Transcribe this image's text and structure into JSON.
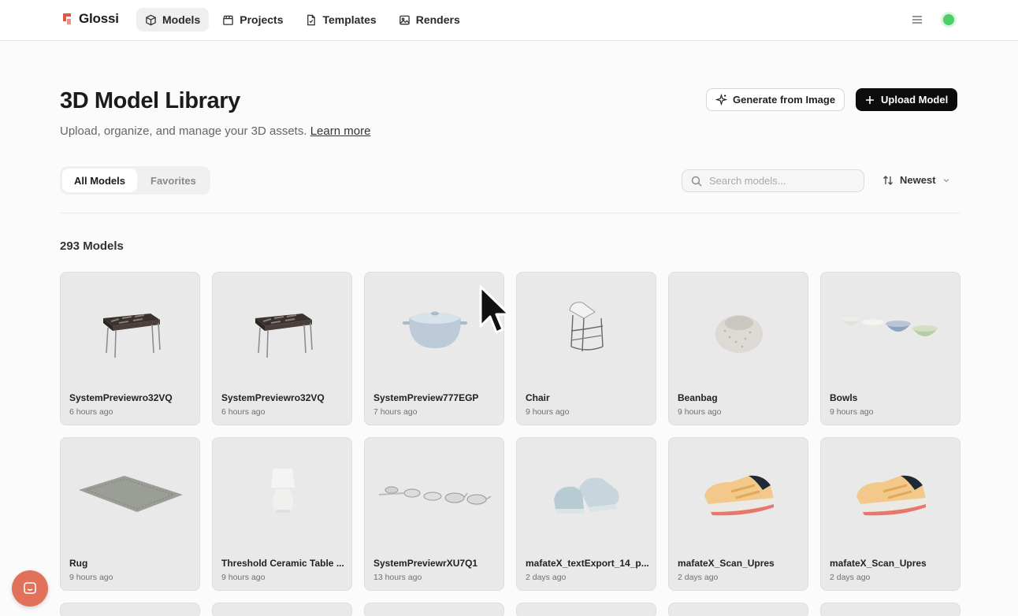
{
  "brand": {
    "name": "Glossi",
    "accent": "#e2563f"
  },
  "nav": [
    {
      "label": "Models",
      "icon": "cube-icon",
      "active": true
    },
    {
      "label": "Projects",
      "icon": "clapper-icon",
      "active": false
    },
    {
      "label": "Templates",
      "icon": "file-icon",
      "active": false
    },
    {
      "label": "Renders",
      "icon": "image-icon",
      "active": false
    }
  ],
  "header": {
    "title": "3D Model Library",
    "subtitle": "Upload, organize, and manage your 3D assets.",
    "learn_more": "Learn more",
    "generate_label": "Generate from Image",
    "upload_label": "Upload Model"
  },
  "filters": {
    "tabs": [
      "All Models",
      "Favorites"
    ],
    "active_tab": "All Models",
    "search_placeholder": "Search models...",
    "sort_label": "Newest"
  },
  "count_label": "293 Models",
  "models": [
    {
      "name": "SystemPreviewro32VQ",
      "time": "6 hours ago",
      "thumb": "table"
    },
    {
      "name": "SystemPreviewro32VQ",
      "time": "6 hours ago",
      "thumb": "table"
    },
    {
      "name": "SystemPreview777EGP",
      "time": "7 hours ago",
      "thumb": "pot"
    },
    {
      "name": "Chair",
      "time": "9 hours ago",
      "thumb": "chair"
    },
    {
      "name": "Beanbag",
      "time": "9 hours ago",
      "thumb": "beanbag"
    },
    {
      "name": "Bowls",
      "time": "9 hours ago",
      "thumb": "bowls"
    },
    {
      "name": "Rug",
      "time": "9 hours ago",
      "thumb": "rug"
    },
    {
      "name": "Threshold Ceramic Table ...",
      "time": "9 hours ago",
      "thumb": "lamp"
    },
    {
      "name": "SystemPreviewrXU7Q1",
      "time": "13 hours ago",
      "thumb": "pans"
    },
    {
      "name": "mafateX_textExport_14_p...",
      "time": "2 days ago",
      "thumb": "shoe-blue"
    },
    {
      "name": "mafateX_Scan_Upres",
      "time": "2 days ago",
      "thumb": "shoe-orange"
    },
    {
      "name": "mafateX_Scan_Upres",
      "time": "2 days ago",
      "thumb": "shoe-orange"
    }
  ],
  "colors": {
    "status": "#4ccf6a",
    "chat": "#e2715a",
    "primary": "#0c0c0c"
  }
}
